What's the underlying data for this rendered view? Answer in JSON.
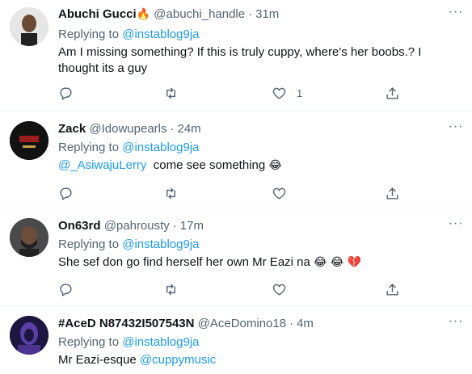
{
  "replying_to_label": "Replying to",
  "replying_to_handle": "@instablog9ja",
  "more_label": "···",
  "tweets": [
    {
      "name": "Abuchi Gucci",
      "name_emoji": "🔥",
      "handle": "@abuchi_handle",
      "time": "31m",
      "text": "Am I missing something? If this is truly cuppy, where's her boobs.? I thought its a guy",
      "like_count": "1",
      "avatar_color": "#c9c9c9"
    },
    {
      "name": "Zack",
      "handle": "@Idowupearls",
      "time": "24m",
      "text_mention": "@_AsiwajuLerry",
      "text": "come see something",
      "text_emoji": "😂",
      "avatar_color": "#1a1a1a"
    },
    {
      "name": "On63rd",
      "handle": "@pahrousty",
      "time": "17m",
      "text": "She sef don go find herself her own Mr Eazi na",
      "text_emoji": "😂 😂 💔",
      "avatar_color": "#3a3a3a"
    },
    {
      "name": "#AceD N87432I507543N",
      "handle": "@AceDomino18",
      "time": "4m",
      "text": "Mr Eazi-esque",
      "text_mention": "@cuppymusic",
      "avatar_color": "#3b2a6b"
    }
  ],
  "colors": {
    "accent": "#1d9bf0",
    "secondary_text": "#536471",
    "divider": "#eff3f4"
  },
  "icons": [
    "reply-icon",
    "retweet-icon",
    "like-icon",
    "share-icon",
    "more-icon"
  ]
}
